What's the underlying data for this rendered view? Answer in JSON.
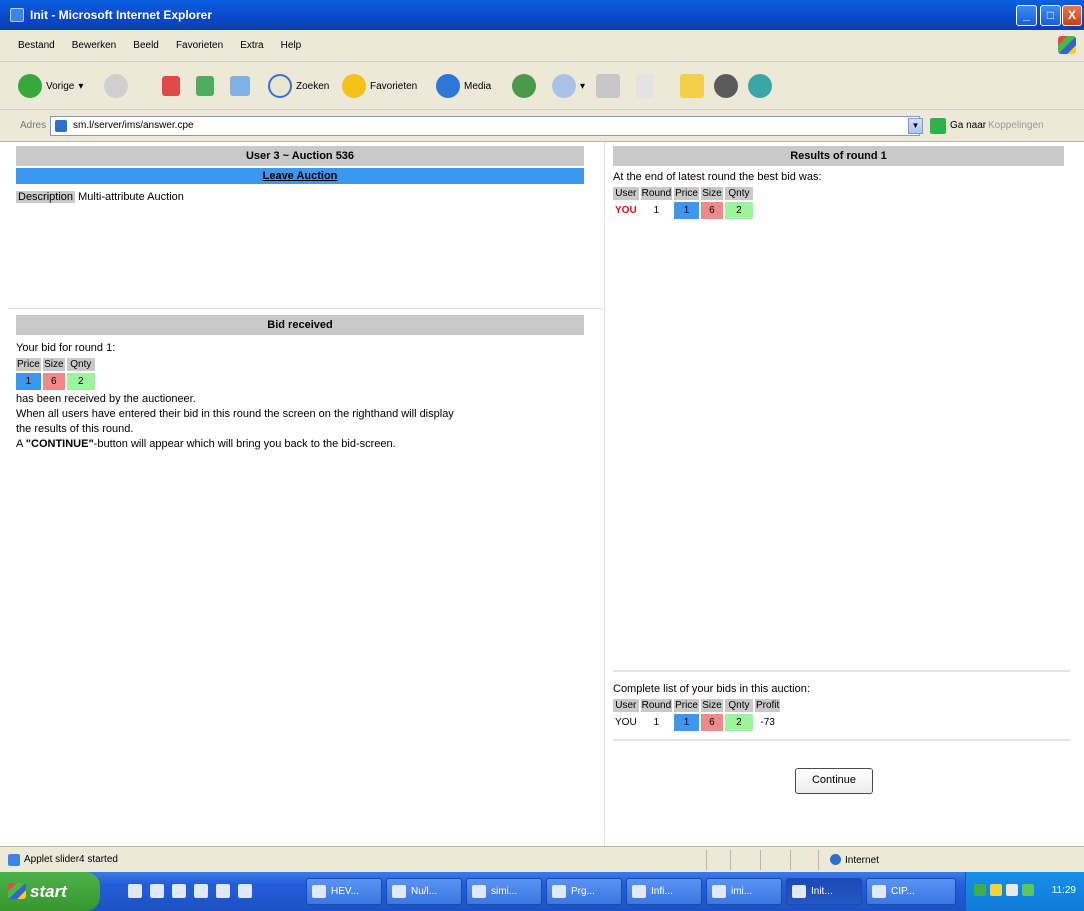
{
  "window": {
    "title": "Init - Microsoft Internet Explorer",
    "min": "_",
    "max": "□",
    "close": "X"
  },
  "menu": [
    "Bestand",
    "Bewerken",
    "Beeld",
    "Favorieten",
    "Extra",
    "Help"
  ],
  "toolbar": {
    "back": "Vorige",
    "search": "Zoeken",
    "favorites": "Favorieten",
    "media": "Media"
  },
  "address": {
    "label": "Adres",
    "url": "sm.l/server/ims/answer.cpe",
    "go": "Ga naar",
    "links": "Koppelingen"
  },
  "left_top": {
    "header": "User 3 ~ Auction 536",
    "leave": "Leave Auction",
    "description_label": "Description",
    "description_value": "Multi-attribute Auction"
  },
  "left_bottom": {
    "header": "Bid received",
    "intro": "Your bid for round 1:",
    "columns": [
      "Price",
      "Size",
      "Qnty"
    ],
    "values": [
      "1",
      "6",
      "2"
    ],
    "line1": "has been received by the auctioneer.",
    "line2": "When all users have entered their bid in this round the screen on the righthand will display",
    "line3": "the results of this round.",
    "line4_prefix": "A ",
    "line4_bold": "\"CONTINUE\"",
    "line4_suffix": "-button will appear which will bring you back to the bid-screen."
  },
  "right_top": {
    "header": "Results of round 1",
    "intro": "At the end of latest round the best bid was:",
    "columns": [
      "User",
      "Round",
      "Price",
      "Size",
      "Qnty"
    ],
    "row": [
      "YOU",
      "1",
      "1",
      "6",
      "2"
    ]
  },
  "right_bottom": {
    "intro": "Complete list of your bids in this auction:",
    "columns": [
      "User",
      "Round",
      "Price",
      "Size",
      "Qnty",
      "Profit"
    ],
    "row": [
      "YOU",
      "1",
      "1",
      "6",
      "2",
      "-73"
    ],
    "continue": "Continue"
  },
  "status": {
    "message": "Applet slider4 started",
    "zone": "Internet"
  },
  "taskbar": {
    "start": "start",
    "tasks": [
      "HEV...",
      "Nu/l...",
      "simi...",
      "Prg...",
      "Infi...",
      "imi...",
      "Init...",
      "CIP..."
    ],
    "clock": "11:29"
  },
  "colors": {
    "price": "#3c97ee",
    "size": "#ef8a8a",
    "qnty": "#9cf59c",
    "header_grey": "#c9c9c9",
    "you_red": "#e01010"
  }
}
